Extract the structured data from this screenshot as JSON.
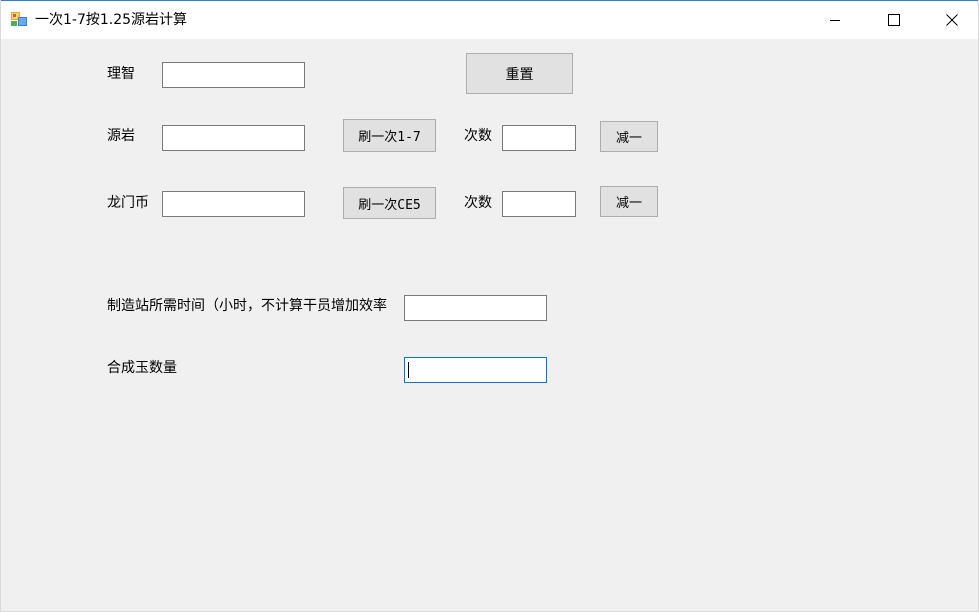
{
  "window": {
    "title": "一次1-7按1.25源岩计算",
    "minimize_icon": "minimize-icon",
    "maximize_icon": "maximize-icon",
    "close_icon": "close-icon"
  },
  "form": {
    "lizhi_label": "理智",
    "lizhi_value": "",
    "reset_label": "重置",
    "yuanyan_label": "源岩",
    "yuanyan_value": "",
    "refresh_17_label": "刷一次1-7",
    "count1_label": "次数",
    "count1_value": "",
    "minus1_label": "减一",
    "longmenbi_label": "龙门币",
    "longmenbi_value": "",
    "refresh_ce5_label": "刷一次CE5",
    "count2_label": "次数",
    "count2_value": "",
    "minus2_label": "减一",
    "factory_time_label": "制造站所需时间（小时，不计算干员增加效率",
    "factory_time_value": "",
    "jade_count_label": "合成玉数量",
    "jade_count_value": ""
  }
}
